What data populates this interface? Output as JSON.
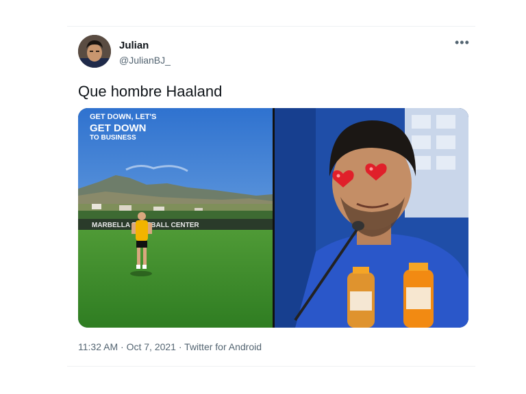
{
  "tweet": {
    "author": {
      "display_name": "Julian",
      "handle": "@JulianBJ_"
    },
    "text": "Que hombre Haaland",
    "media": {
      "left_overlay": {
        "line1": "GET DOWN, LET'S",
        "line2": "GET DOWN",
        "line3": "TO BUSINESS"
      },
      "left_sign_text": "MARBELLA FOOTBALL CENTER"
    },
    "meta": {
      "time": "11:32 AM",
      "separator1": " · ",
      "date": "Oct 7, 2021",
      "separator2": " · ",
      "source": "Twitter for Android"
    },
    "more_icon": "more-horizontal-icon"
  },
  "colors": {
    "name": "#0f1419",
    "secondary": "#536471",
    "grass": "#3f8f2c",
    "sky": "#3f86d6",
    "jersey_blue": "#1f4fb8"
  }
}
